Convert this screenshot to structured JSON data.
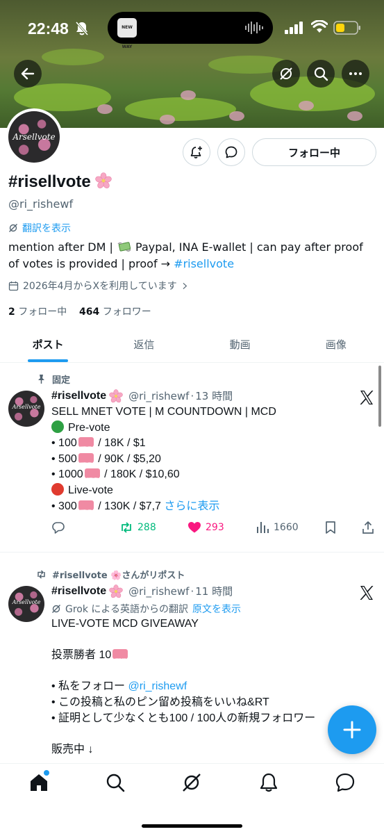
{
  "status_bar": {
    "time": "22:48",
    "island_art_text": "NEW WAY",
    "icons": [
      "bell-off-icon",
      "signal-icon",
      "wifi-icon",
      "battery-low-icon"
    ],
    "battery_color": "#ffd60a"
  },
  "profile": {
    "avatar_signature": "Arsellvote",
    "display_name": "#risellvote",
    "name_emoji": "cherry-blossom-icon",
    "handle": "@ri_rishewf",
    "translate_label": "翻訳を表示",
    "bio_part1": "mention after DM | ",
    "bio_part2": " Paypal, INA E-wallet | can pay after proof of votes is provided | proof → ",
    "bio_link": "#risellvote",
    "joined": "2026年4月からXを利用しています",
    "following_count": "2",
    "following_label": "フォロー中",
    "followers_count": "464",
    "followers_label": "フォロワー",
    "follow_button": "フォロー中"
  },
  "tabs": [
    {
      "label": "ポスト",
      "active": true
    },
    {
      "label": "返信",
      "active": false
    },
    {
      "label": "動画",
      "active": false
    },
    {
      "label": "画像",
      "active": false
    }
  ],
  "posts": [
    {
      "context": "固定",
      "name": "#risellvote",
      "handle": "@ri_rishewf",
      "time": "13 時間",
      "lines": {
        "l1": "SELL MNET VOTE | M COUNTDOWN | MCD",
        "l2": "Pre-vote",
        "l3a": "• 100",
        "l3b": " / 18K / $1",
        "l4a": "• 500",
        "l4b": " / 90K / $5,20",
        "l5a": "• 1000",
        "l5b": " / 180K / $10,60",
        "l6": "Live-vote",
        "l7a": "• 300",
        "l7b": " / 130K / $7,7 ",
        "more": "さらに表示"
      },
      "actions": {
        "reposts": "288",
        "likes": "293",
        "views": "1660"
      },
      "repost_color": "#00ba7c",
      "like_color": "#f91880"
    },
    {
      "context": "#risellvote 🌸さんがリポスト",
      "name": "#risellvote",
      "handle": "@ri_rishewf",
      "time": "11 時間",
      "translate_note": "Grok による英語からの翻訳",
      "translate_link": "原文を表示",
      "lines": {
        "l1": "LIVE-VOTE MCD GIVEAWAY",
        "l2": "投票勝者 10",
        "l3a": "• 私をフォロー ",
        "l3b": "@ri_rishewf",
        "l4": "• この投稿と私のピン留め投稿をいいね&RT",
        "l5": "• 証明として少なくとも100 / 100人の新規フォロワー",
        "l6": "販売中 ↓"
      }
    }
  ],
  "bottom_nav": [
    "home-icon",
    "search-icon",
    "grok-icon",
    "notifications-icon",
    "messages-icon"
  ],
  "accent_color": "#1d9bf0"
}
